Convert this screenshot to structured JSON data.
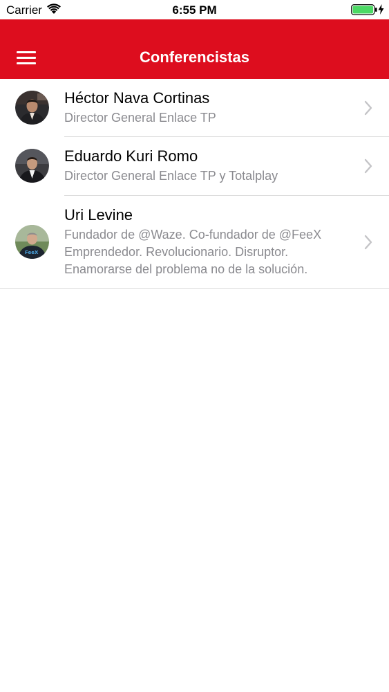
{
  "status_bar": {
    "carrier": "Carrier",
    "time": "6:55 PM",
    "battery_color": "#4cd964"
  },
  "nav": {
    "title": "Conferencistas",
    "background_color": "#dd0d1e",
    "menu_icon": "hamburger-menu-icon"
  },
  "speakers": [
    {
      "name": "Héctor Nava Cortinas",
      "title_lines": [
        "Director General Enlace TP"
      ]
    },
    {
      "name": "Eduardo Kuri Romo",
      "title_lines": [
        "Director General Enlace TP y Totalplay"
      ]
    },
    {
      "name": "Uri Levine",
      "title_lines": [
        "Fundador de @Waze. Co-fundador de @FeeX",
        "Emprendedor. Revolucionario. Disruptor.",
        "Enamorarse del problema no de la solución."
      ]
    }
  ]
}
